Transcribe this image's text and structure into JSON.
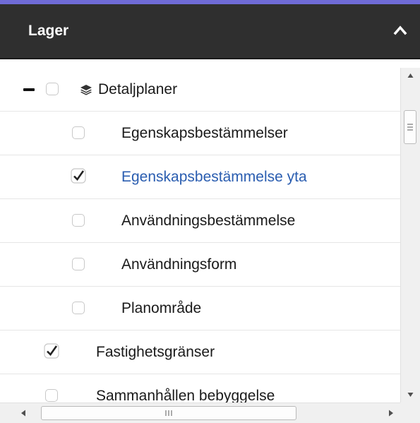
{
  "panel": {
    "title": "Lager",
    "collapse_icon": "chevron-up-icon"
  },
  "layers": {
    "group": {
      "label": "Detaljplaner",
      "checked": false,
      "expanded": true
    },
    "children": [
      {
        "label": "Egenskapsbestämmelser",
        "checked": false,
        "active": false
      },
      {
        "label": "Egenskapsbestämmelse yta",
        "checked": true,
        "active": true
      },
      {
        "label": "Användningsbestämmelse",
        "checked": false,
        "active": false
      },
      {
        "label": "Användningsform",
        "checked": false,
        "active": false
      },
      {
        "label": "Planområde",
        "checked": false,
        "active": false
      }
    ],
    "top_level": [
      {
        "label": "Fastighetsgränser",
        "checked": true
      },
      {
        "label": "Sammanhållen bebyggelse",
        "checked": false
      }
    ]
  },
  "colors": {
    "header_bg": "#2f2f2f",
    "accent_bar": "#6f6bd6",
    "active_text": "#2a5db0"
  }
}
